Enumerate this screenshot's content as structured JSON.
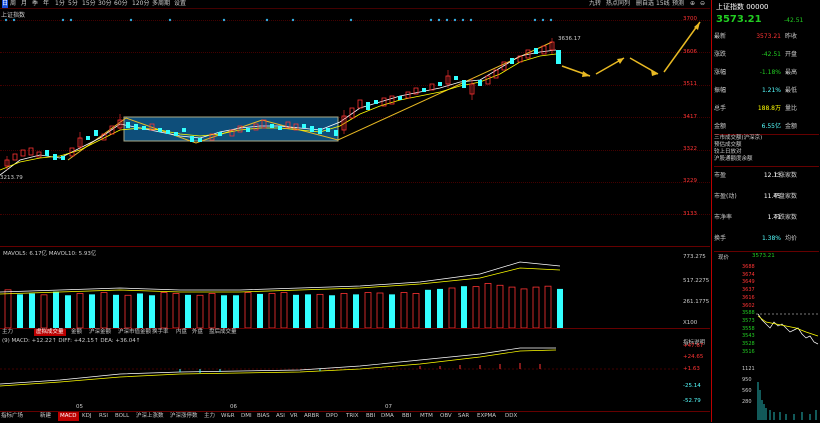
{
  "topbar": {
    "items": [
      {
        "label": "周",
        "name": "toolbar-week"
      },
      {
        "label": "月",
        "name": "toolbar-month"
      },
      {
        "label": "季",
        "name": "toolbar-quarter"
      },
      {
        "label": "年",
        "name": "toolbar-year"
      },
      {
        "label": "1分",
        "name": "toolbar-1min"
      },
      {
        "label": "5分",
        "name": "toolbar-5min"
      },
      {
        "label": "15分",
        "name": "toolbar-15min"
      },
      {
        "label": "30分",
        "name": "toolbar-30min"
      },
      {
        "label": "60分",
        "name": "toolbar-60min"
      },
      {
        "label": "120分",
        "name": "toolbar-120min"
      },
      {
        "label": "多周期",
        "name": "toolbar-multi"
      },
      {
        "label": "设置",
        "name": "toolbar-settings"
      }
    ],
    "right_items": [
      "九转",
      "热点同列",
      "删自选",
      "15线",
      "预测"
    ]
  },
  "chart": {
    "title": "上证指数",
    "y_ticks": [
      "3700",
      "3606",
      "3511",
      "3417",
      "3322",
      "3229",
      "3133"
    ],
    "high_label": "3636.17",
    "low_label": "3213.79",
    "volume_legend": "MAVOL5: 6.17亿  MAVOL10: 5.93亿",
    "volume_ticks": [
      "773.275",
      "517.2275",
      "261.1775",
      "X100"
    ],
    "macd_legend": "(9) MACD: +12.22↑  DIFF: +42.15↑  DEA: +36.04↑",
    "macd_ticks": [
      "+47.67",
      "+24.65",
      "+1.63",
      "-25.14",
      "-52.79"
    ],
    "macd_side": "指标说明",
    "months": [
      "05",
      "06",
      "07"
    ],
    "volume_series": [
      420,
      370,
      380,
      365,
      400,
      360,
      380,
      370,
      390,
      365,
      360,
      380,
      360,
      390,
      380,
      365,
      360,
      380,
      360,
      360,
      390,
      375,
      380,
      390,
      365,
      370,
      370,
      360,
      380,
      370,
      390,
      385,
      370,
      390,
      380,
      420,
      430,
      440,
      460,
      455,
      490,
      470,
      450,
      430,
      450,
      460,
      430
    ],
    "volume_colors": [
      "red",
      "cyan",
      "cyan",
      "red",
      "cyan",
      "cyan",
      "red",
      "cyan",
      "red",
      "cyan",
      "red",
      "cyan",
      "cyan",
      "red",
      "red",
      "cyan",
      "red",
      "red",
      "cyan",
      "cyan",
      "red",
      "cyan",
      "red",
      "red",
      "cyan",
      "cyan",
      "red",
      "cyan",
      "red",
      "cyan",
      "red",
      "red",
      "cyan",
      "red",
      "red",
      "cyan",
      "cyan",
      "red",
      "cyan",
      "red",
      "red",
      "red",
      "red",
      "red",
      "red",
      "red",
      "cyan"
    ]
  },
  "tabs": [
    "主力",
    "虚拟成交量",
    "金额",
    "沪深金额",
    "沪深市值金额",
    "换手率",
    "内盘",
    "外盘",
    "盘后成交量"
  ],
  "active_tab": "虚拟成交量",
  "bottom_tabs": [
    "指标广场",
    "新建",
    "MACD",
    "KDJ",
    "RSI",
    "BOLL",
    "沪深上涨数",
    "沪深涨停数",
    "主力",
    "W&R",
    "DMI",
    "BIAS",
    "ASI",
    "VR",
    "ARBR",
    "DPO",
    "TRIX",
    "BBI",
    "DMA",
    "BBI",
    "MTM",
    "OBV",
    "SAR",
    "EXPMA",
    "DDX"
  ],
  "right": {
    "name": "上证指数 00000",
    "price": "3573.21",
    "change": "-42.51",
    "rows": [
      {
        "k": "最新",
        "v": "3573.21",
        "k2": "昨收",
        "c": "red"
      },
      {
        "k": "涨跌",
        "v": "-42.51",
        "k2": "开盘",
        "c": "green"
      },
      {
        "k": "涨幅",
        "v": "-1.18%",
        "k2": "最高",
        "c": "green"
      },
      {
        "k": "振幅",
        "v": "1.21%",
        "k2": "最低",
        "c": "cyan"
      },
      {
        "k": "总手",
        "v": "188.8万",
        "k2": "量比",
        "c": "yellow"
      },
      {
        "k": "金额",
        "v": "6.55亿",
        "k2": "金额",
        "c": "cyan"
      }
    ],
    "block_lines": [
      "三市成交额(沪深京)",
      "预估成交额",
      "较上日放对",
      "沪股通额度余额"
    ],
    "stats": [
      {
        "k": "市盈",
        "v": "12.13",
        "k2": "上涨家数"
      },
      {
        "k": "市盈(动)",
        "v": "11.45",
        "k2": "平盘家数"
      },
      {
        "k": "市净率",
        "v": "1.41",
        "k2": "下跌家数"
      },
      {
        "k": "换手",
        "v": "1.38%",
        "k2": "均价"
      }
    ],
    "mini_label": "现价",
    "mini_price": "3573.21",
    "mini_ticks": [
      "3688",
      "3674",
      "3649",
      "3637",
      "3616",
      "3602",
      "3588",
      "3573",
      "3558",
      "3543",
      "3528",
      "3516"
    ],
    "mini_vol_ticks": [
      "1121",
      "950",
      "560",
      "280"
    ]
  }
}
